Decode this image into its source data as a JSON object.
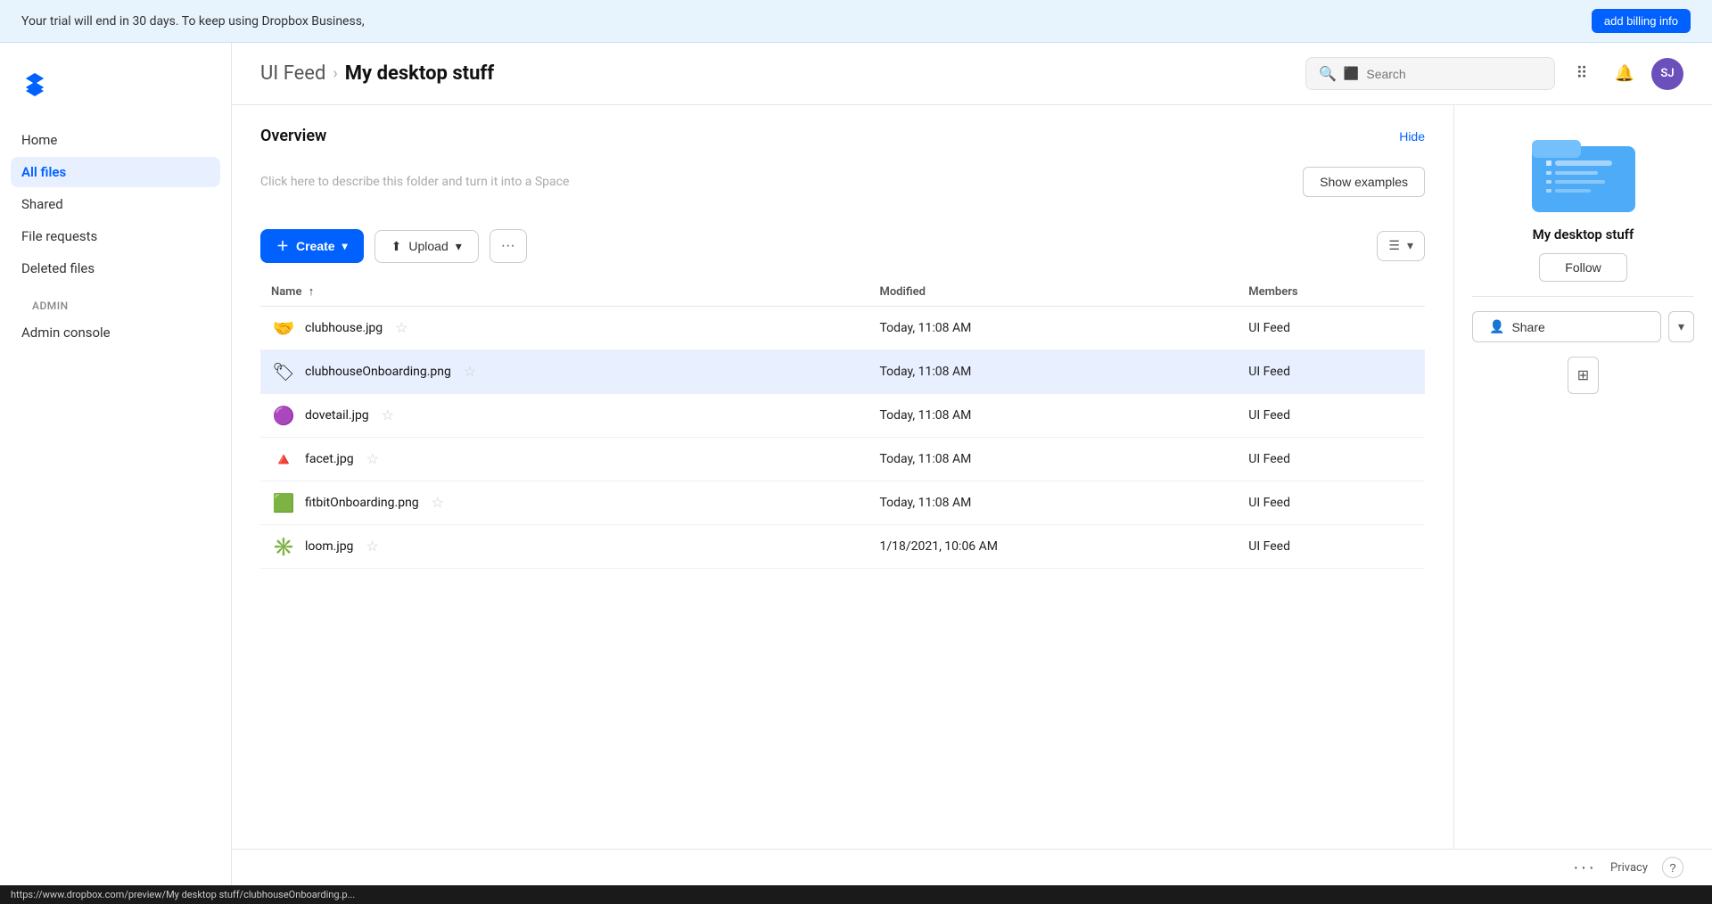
{
  "trial_banner": {
    "message": "Your trial will end in 30 days. To keep using Dropbox Business,",
    "cta_label": "add billing info"
  },
  "sidebar": {
    "items": [
      {
        "id": "home",
        "label": "Home",
        "active": false
      },
      {
        "id": "all-files",
        "label": "All files",
        "active": true
      },
      {
        "id": "shared",
        "label": "Shared",
        "active": false
      },
      {
        "id": "file-requests",
        "label": "File requests",
        "active": false
      },
      {
        "id": "deleted-files",
        "label": "Deleted files",
        "active": false
      }
    ],
    "admin_section_label": "Admin",
    "admin_items": [
      {
        "id": "admin-console",
        "label": "Admin console",
        "active": false
      }
    ]
  },
  "header": {
    "breadcrumb_parent": "UI Feed",
    "breadcrumb_separator": "›",
    "breadcrumb_current": "My desktop stuff",
    "search_placeholder": "Search"
  },
  "overview": {
    "title": "Overview",
    "hide_label": "Hide",
    "description_placeholder": "Click here to describe this folder and turn it into a Space",
    "show_examples_label": "Show examples"
  },
  "toolbar": {
    "create_label": "Create",
    "upload_label": "Upload",
    "more_label": "···"
  },
  "file_table": {
    "columns": [
      {
        "id": "name",
        "label": "Name",
        "sort_arrow": "↑"
      },
      {
        "id": "modified",
        "label": "Modified"
      },
      {
        "id": "members",
        "label": "Members"
      }
    ],
    "files": [
      {
        "id": "clubhouse",
        "name": "clubhouse.jpg",
        "icon": "🤝",
        "modified": "Today, 11:08 AM",
        "members": "UI Feed",
        "highlighted": false
      },
      {
        "id": "clubhouseOnboarding",
        "name": "clubhouseOnboarding.png",
        "icon": "🏷",
        "modified": "Today, 11:08 AM",
        "members": "UI Feed",
        "highlighted": true
      },
      {
        "id": "dovetail",
        "name": "dovetail.jpg",
        "icon": "🟣",
        "modified": "Today, 11:08 AM",
        "members": "UI Feed",
        "highlighted": false
      },
      {
        "id": "facet",
        "name": "facet.jpg",
        "icon": "🔺",
        "modified": "Today, 11:08 AM",
        "members": "UI Feed",
        "highlighted": false
      },
      {
        "id": "fitbitOnboarding",
        "name": "fitbitOnboarding.png",
        "icon": "🟩",
        "modified": "Today, 11:08 AM",
        "members": "UI Feed",
        "highlighted": false
      },
      {
        "id": "loom",
        "name": "loom.jpg",
        "icon": "✳️",
        "modified": "1/18/2021, 10:06 AM",
        "members": "UI Feed",
        "highlighted": false
      }
    ]
  },
  "right_panel": {
    "folder_name": "My desktop stuff",
    "follow_label": "Follow",
    "share_label": "Share"
  },
  "footer": {
    "privacy_label": "Privacy",
    "more_label": "···"
  },
  "status_bar": {
    "url": "https://www.dropbox.com/preview/My desktop stuff/clubhouseOnboarding.p..."
  },
  "avatar": {
    "initials": "SJ"
  }
}
